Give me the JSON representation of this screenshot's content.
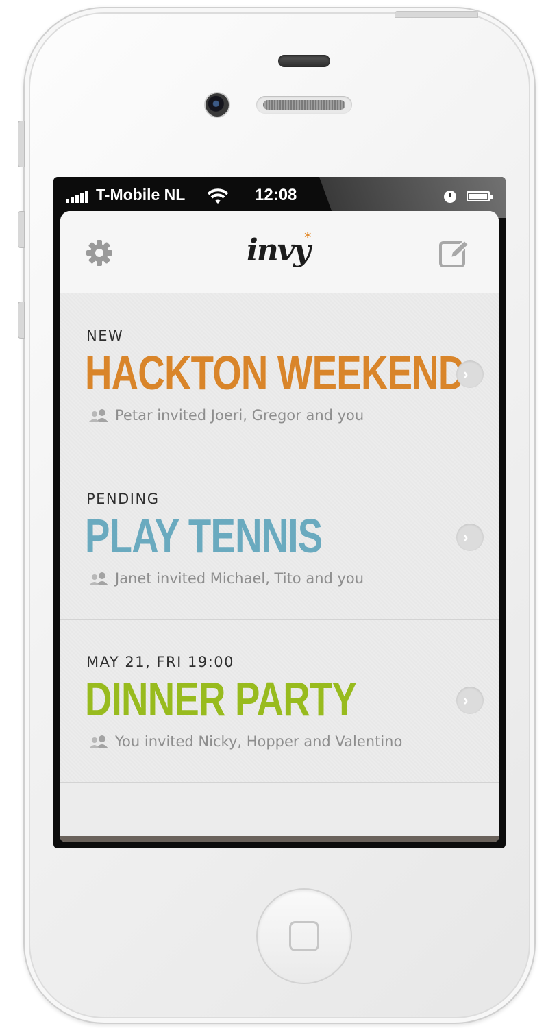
{
  "statusbar": {
    "carrier": "T-Mobile NL",
    "time": "12:08"
  },
  "navbar": {
    "logo": "invy",
    "logo_star": "*"
  },
  "colors": {
    "orange": "#d9852a",
    "blue": "#6aaabf",
    "green": "#98bb1e"
  },
  "events": [
    {
      "status": "NEW",
      "title": "HACKTON WEEKEND",
      "invitees": "Petar invited Joeri, Gregor and you"
    },
    {
      "status": "PENDING",
      "title": "PLAY TENNIS",
      "invitees": "Janet invited Michael, Tito and you"
    },
    {
      "status": "MAY 21, FRI 19:00",
      "title": "DINNER PARTY",
      "invitees": "You invited Nicky, Hopper and Valentino"
    }
  ]
}
